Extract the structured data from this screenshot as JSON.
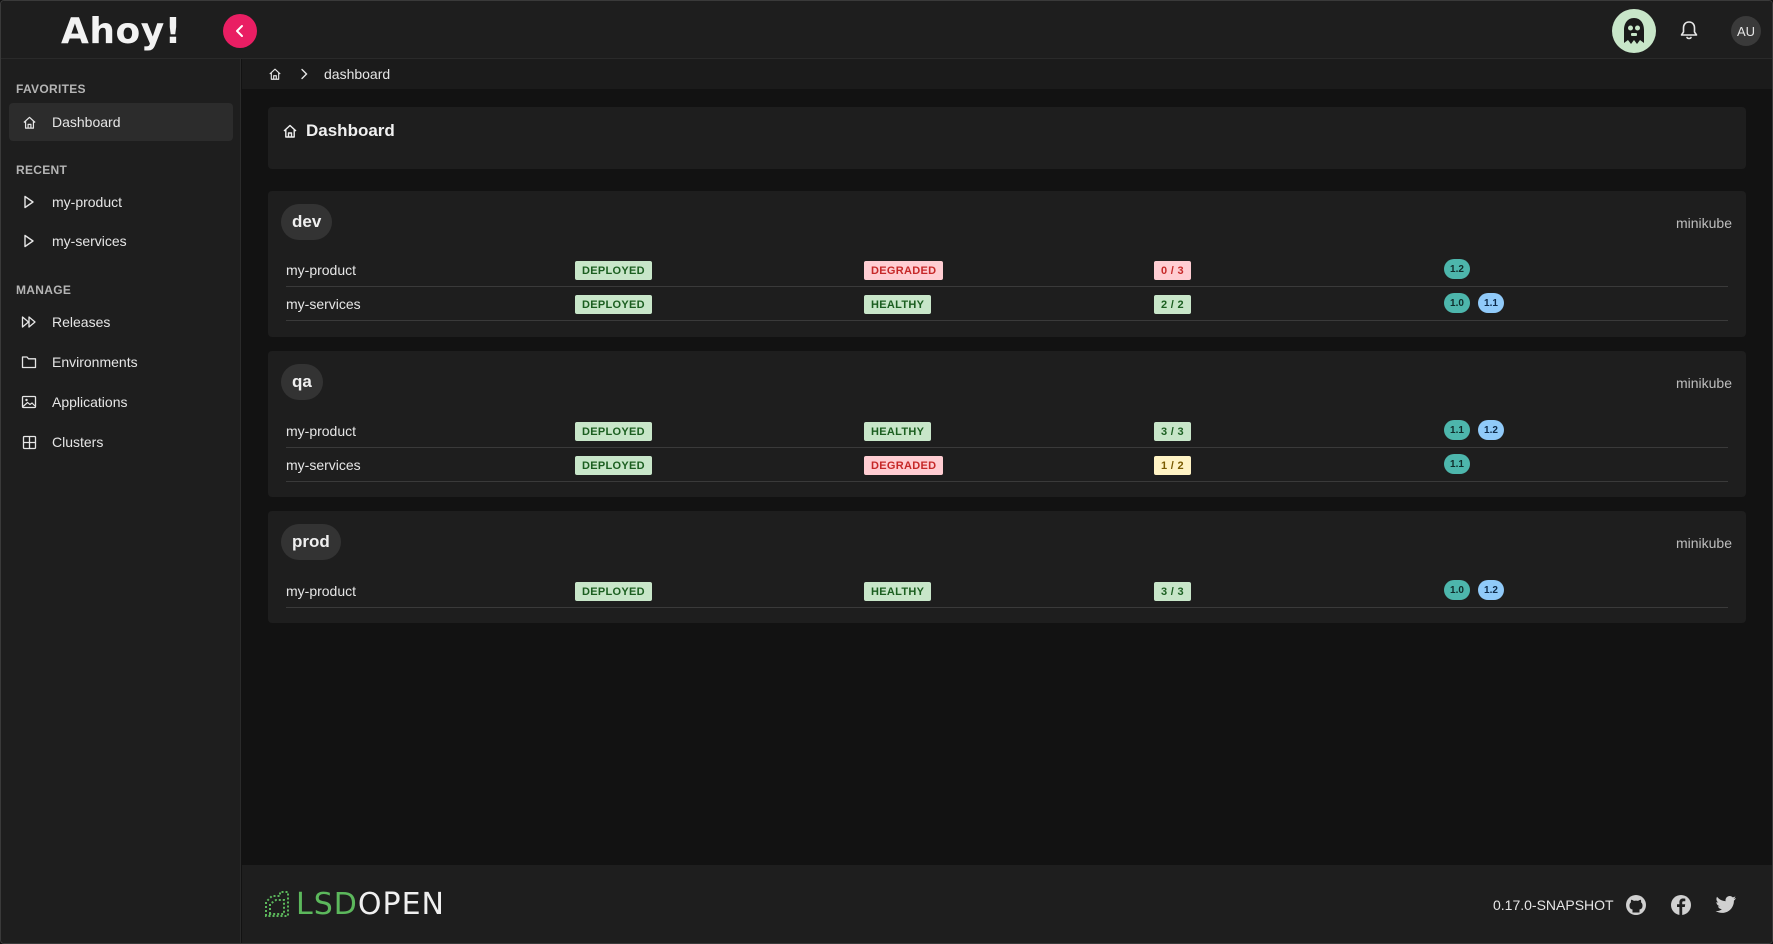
{
  "app": {
    "logo_text": "Ahoy!"
  },
  "topbar": {
    "user_initials": "AU"
  },
  "sidebar": {
    "favorites_title": "FAVORITES",
    "favorites": [
      {
        "label": "Dashboard",
        "icon": "home-icon",
        "active": true
      }
    ],
    "recent_title": "RECENT",
    "recent": [
      {
        "label": "my-product",
        "icon": "play-outline-icon"
      },
      {
        "label": "my-services",
        "icon": "play-outline-icon"
      }
    ],
    "manage_title": "MANAGE",
    "manage": [
      {
        "label": "Releases",
        "icon": "fast-forward-icon"
      },
      {
        "label": "Environments",
        "icon": "folder-icon"
      },
      {
        "label": "Applications",
        "icon": "image-icon"
      },
      {
        "label": "Clusters",
        "icon": "grid-icon"
      }
    ]
  },
  "breadcrumb": {
    "current": "dashboard"
  },
  "page": {
    "title": "Dashboard"
  },
  "environments": [
    {
      "name": "dev",
      "cluster": "minikube",
      "rows": [
        {
          "app": "my-product",
          "status": "DEPLOYED",
          "health": "DEGRADED",
          "count": "0 / 3",
          "versions": [
            "1.2"
          ]
        },
        {
          "app": "my-services",
          "status": "DEPLOYED",
          "health": "HEALTHY",
          "count": "2 / 2",
          "versions": [
            "1.0",
            "1.1"
          ]
        }
      ]
    },
    {
      "name": "qa",
      "cluster": "minikube",
      "rows": [
        {
          "app": "my-product",
          "status": "DEPLOYED",
          "health": "HEALTHY",
          "count": "3 / 3",
          "versions": [
            "1.1",
            "1.2"
          ]
        },
        {
          "app": "my-services",
          "status": "DEPLOYED",
          "health": "DEGRADED",
          "count": "1 / 2",
          "versions": [
            "1.1"
          ]
        }
      ]
    },
    {
      "name": "prod",
      "cluster": "minikube",
      "rows": [
        {
          "app": "my-product",
          "status": "DEPLOYED",
          "health": "HEALTHY",
          "count": "3 / 3",
          "versions": [
            "1.0",
            "1.2"
          ]
        }
      ]
    }
  ],
  "footer": {
    "logo_lsd": "LSD",
    "logo_open": "OPEN",
    "version": "0.17.0-SNAPSHOT"
  },
  "colors": {
    "accent": "#e91e63",
    "badge_green_bg": "#c8e6c9",
    "badge_red_bg": "#ffcdd2",
    "badge_yellow_bg": "#fff3c4",
    "version_teal": "#4db6ac",
    "version_blue": "#90caf9",
    "lsd_green": "#5cb85c"
  }
}
